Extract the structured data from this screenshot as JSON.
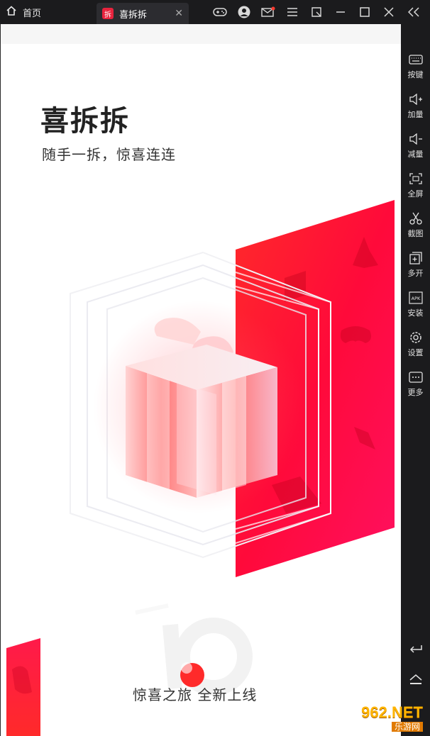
{
  "titlebar": {
    "home_label": "首页",
    "active_tab_label": "喜拆拆",
    "app_icon_glyph": "拆",
    "close_glyph": "✕"
  },
  "app": {
    "logo": "喜拆拆",
    "tagline": "随手一拆，惊喜连连",
    "bottom_text": "惊喜之旅  全新上线",
    "badge_number": "10",
    "accent": "#ff1a3d"
  },
  "sidebar": {
    "items": [
      {
        "label": "按键",
        "icon": "keyboard-icon"
      },
      {
        "label": "加量",
        "icon": "volume-up-icon"
      },
      {
        "label": "减量",
        "icon": "volume-down-icon"
      },
      {
        "label": "全屏",
        "icon": "fullscreen-icon"
      },
      {
        "label": "截图",
        "icon": "scissors-icon"
      },
      {
        "label": "多开",
        "icon": "multi-open-icon"
      },
      {
        "label": "安装",
        "icon": "apk-icon"
      },
      {
        "label": "设置",
        "icon": "gear-icon"
      },
      {
        "label": "更多",
        "icon": "more-icon"
      }
    ],
    "apk_glyph": "APK"
  },
  "watermark": {
    "text": "962.NET",
    "subtext": "乐游网"
  }
}
